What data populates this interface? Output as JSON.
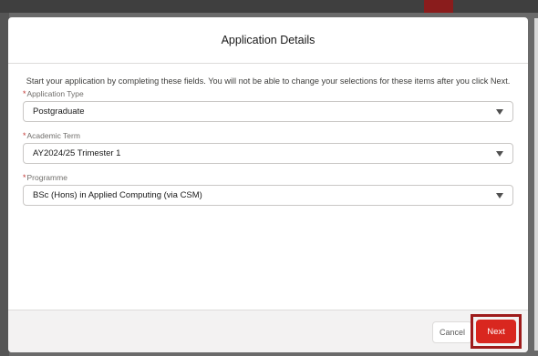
{
  "modal": {
    "title": "Application Details",
    "instruction": "Start your application by completing these fields. You will not be able to change your selections for these items after you click Next."
  },
  "fields": [
    {
      "label": "Application Type",
      "required": "*",
      "value": "Postgraduate"
    },
    {
      "label": "Academic Term",
      "required": "*",
      "value": "AY2024/25 Trimester 1"
    },
    {
      "label": "Programme",
      "required": "*",
      "value": "BSc (Hons) in Applied Computing (via CSM)"
    }
  ],
  "footer": {
    "cancel_label": "Cancel",
    "next_label": "Next"
  },
  "colors": {
    "accent": "#d9271f",
    "highlight_border": "#9e1b1b",
    "required": "#c23934"
  },
  "icons": {
    "select_arrow": "chevron-down-icon"
  }
}
